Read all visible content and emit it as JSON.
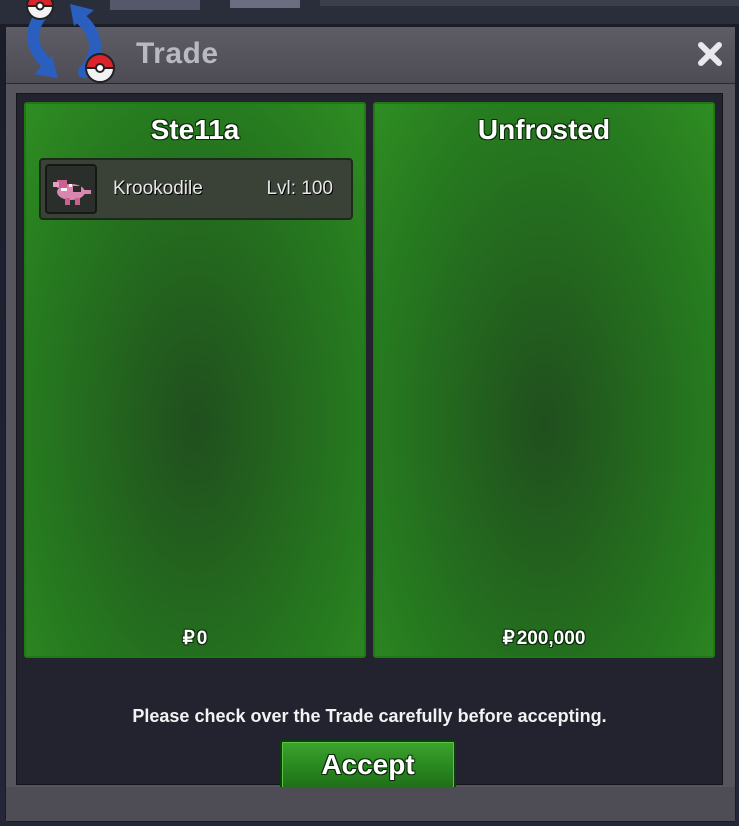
{
  "window": {
    "title": "Trade",
    "close_icon": "close-x-icon",
    "trade_icon": "trade-swap-pokeball-icon"
  },
  "trade": {
    "left_panel": {
      "player_name": "Ste11a",
      "items": [
        {
          "sprite_icon": "krookodile-sprite-icon",
          "name": "Krookodile",
          "level": "Lvl: 100"
        }
      ],
      "currency_symbol": "₽",
      "money": "0"
    },
    "right_panel": {
      "player_name": "Unfrosted",
      "items": [],
      "currency_symbol": "₽",
      "money": "200,000"
    },
    "notice": "Please check over the Trade carefully before accepting.",
    "accept_label": "Accept"
  },
  "colors": {
    "panel_green": "#267a1f",
    "panel_border": "#1f7a14",
    "window_gray": "#56555e",
    "content_dark": "#23232f",
    "pokeball_red": "#d8242a",
    "arrow_blue": "#2a5fbf"
  }
}
